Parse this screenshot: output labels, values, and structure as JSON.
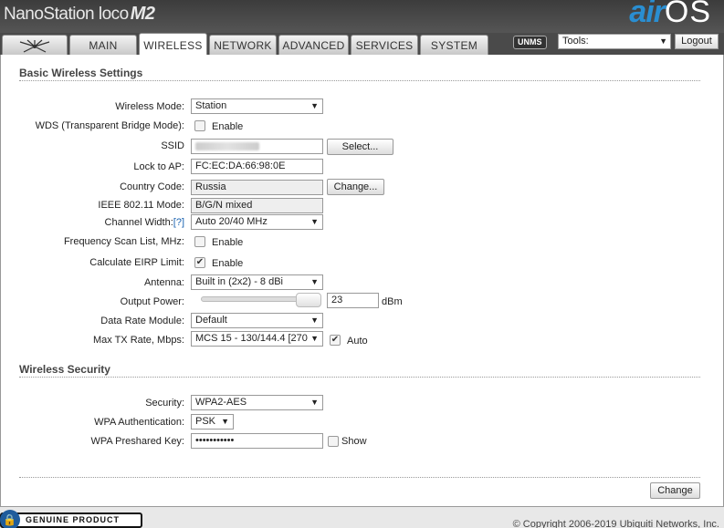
{
  "header": {
    "product_name": "NanoStation loco",
    "product_model": "M2",
    "brand_air": "air",
    "brand_os": "OS"
  },
  "tabs": [
    {
      "label": "",
      "icon": "ubiquiti-logo-icon"
    },
    {
      "label": "MAIN"
    },
    {
      "label": "WIRELESS",
      "active": true
    },
    {
      "label": "NETWORK"
    },
    {
      "label": "ADVANCED"
    },
    {
      "label": "SERVICES"
    },
    {
      "label": "SYSTEM"
    }
  ],
  "toolbar": {
    "unms_label": "UNMS",
    "tools_value": "Tools:",
    "logout_label": "Logout"
  },
  "basic": {
    "title": "Basic Wireless Settings",
    "wireless_mode_label": "Wireless Mode:",
    "wireless_mode_value": "Station",
    "wds_label": "WDS (Transparent Bridge Mode):",
    "wds_enable": "Enable",
    "ssid_label": "SSID",
    "select_button": "Select...",
    "lock_ap_label": "Lock to AP:",
    "lock_ap_value": "FC:EC:DA:66:98:0E",
    "country_label": "Country Code:",
    "country_value": "Russia",
    "change_button": "Change...",
    "ieee_label": "IEEE 802.11 Mode:",
    "ieee_value": "B/G/N mixed",
    "channel_width_label": "Channel Width:",
    "channel_width_help": "[?]",
    "channel_width_value": "Auto 20/40 MHz",
    "freq_scan_label": "Frequency Scan List, MHz:",
    "freq_scan_enable": "Enable",
    "eirp_label": "Calculate EIRP Limit:",
    "eirp_enable": "Enable",
    "antenna_label": "Antenna:",
    "antenna_value": "Built in (2x2) - 8 dBi",
    "output_power_label": "Output Power:",
    "output_power_value": "23",
    "output_power_unit": "dBm",
    "data_rate_label": "Data Rate Module:",
    "data_rate_value": "Default",
    "max_tx_label": "Max TX Rate, Mbps:",
    "max_tx_value": "MCS 15 - 130/144.4 [270",
    "max_tx_auto": "Auto"
  },
  "security": {
    "title": "Wireless Security",
    "security_label": "Security:",
    "security_value": "WPA2-AES",
    "wpa_auth_label": "WPA Authentication:",
    "wpa_auth_value": "PSK",
    "wpa_key_label": "WPA Preshared Key:",
    "wpa_key_value": "•••••••••••",
    "show_label": "Show"
  },
  "footer": {
    "change_button": "Change",
    "genuine_text": "GENUINE PRODUCT",
    "copyright": "© Copyright 2006-2019 Ubiquiti Networks, Inc."
  },
  "colors": {
    "accent_blue": "#2a8ed1",
    "header_bg": "#4a4a4a"
  }
}
